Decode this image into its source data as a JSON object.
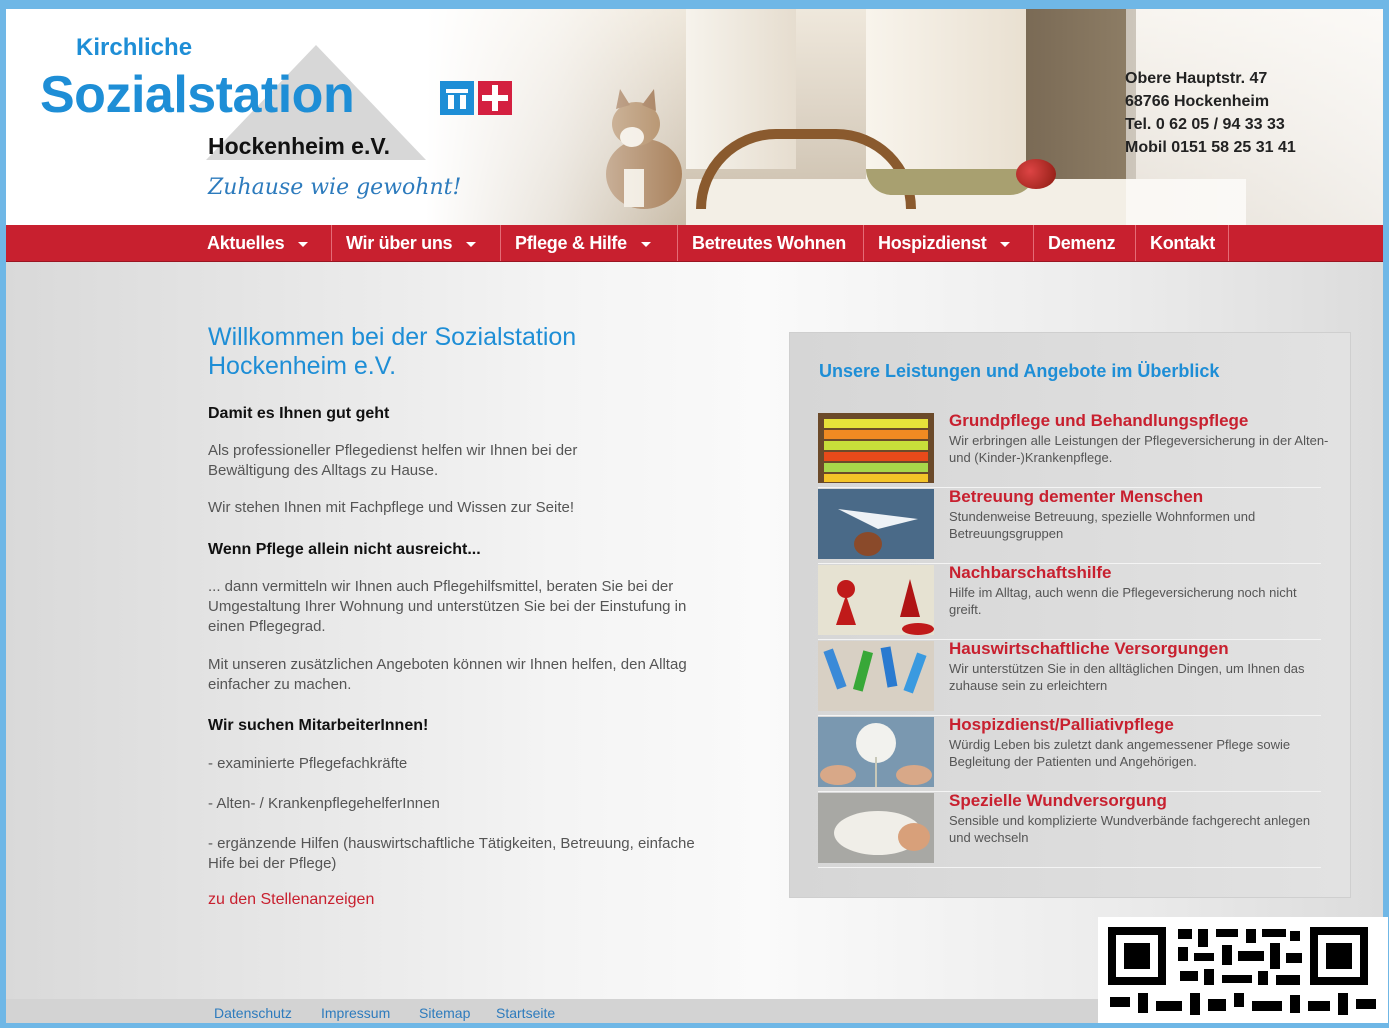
{
  "header": {
    "logo_small": "Kirchliche",
    "logo_big": "Sozialstation",
    "logo_sub": "Hockenheim e.V.",
    "slogan": "Zuhause wie gewohnt!",
    "contact": [
      "Obere Hauptstr. 47",
      "68766 Hockenheim",
      "Tel. 0 62 05 / 94 33 33",
      "Mobil 0151 58 25 31 41"
    ]
  },
  "nav": {
    "items": [
      {
        "label": "Aktuelles"
      },
      {
        "label": "Wir über uns"
      },
      {
        "label": "Pflege & Hilfe"
      },
      {
        "label": "Betreutes Wohnen"
      },
      {
        "label": "Hospizdienst"
      },
      {
        "label": "Demenz"
      },
      {
        "label": "Kontakt"
      }
    ]
  },
  "main": {
    "welcome": "Willkommen bei der Sozialstation Hockenheim e.V.",
    "h1": "Damit es Ihnen gut geht",
    "p1": "Als professioneller Pflegedienst helfen wir Ihnen bei der Bewältigung des Alltags zu Hause.",
    "p2": "Wir stehen Ihnen mit Fachpflege und Wissen zur Seite!",
    "h2": "Wenn Pflege allein nicht ausreicht...",
    "p3": "... dann vermitteln wir Ihnen auch Pflegehilfsmittel, beraten Sie bei der Umgestaltung Ihrer Wohnung und unterstützen Sie bei der Einstufung in einen Pflegegrad.",
    "p4": "Mit unseren zusätzlichen Angeboten können wir Ihnen helfen, den Alltag einfacher zu machen.",
    "h3": "Wir suchen MitarbeiterInnen!",
    "job1": "- examinierte Pflegefachkräfte",
    "job2": "- Alten- / KrankenpflegehelferInnen",
    "job3": "- ergänzende Hilfen (hauswirtschaftliche Tätigkeiten, Betreuung, einfache Hife bei der Pflege)",
    "jobs_link": "zu den Stellenanzeigen"
  },
  "services": {
    "title": "Unsere Leistungen und Angebote im Überblick",
    "items": [
      {
        "title": "Grundpflege und Behandlungspflege",
        "desc": "Wir erbringen alle Leistungen der Pflegeversicherung in der Alten- und (Kinder-)Krankenpflege."
      },
      {
        "title": "Betreuung dementer Menschen",
        "desc": "Stundenweise Betreuung, spezielle Wohnformen und Betreuungsgruppen"
      },
      {
        "title": "Nachbarschaftshilfe",
        "desc": "Hilfe im Alltag, auch wenn die Pflegeversicherung noch nicht greift."
      },
      {
        "title": "Hauswirtschaftliche Versorgungen",
        "desc": "Wir unterstützen Sie in den alltäglichen Dingen, um Ihnen das zuhause sein zu erleichtern"
      },
      {
        "title": "Hospizdienst/Palliativpflege",
        "desc": "Würdig Leben bis zuletzt dank angemessener Pflege sowie Begleitung der Patienten und Angehörigen."
      },
      {
        "title": "Spezielle Wundversorgung",
        "desc": "Sensible und komplizierte Wundverbände fachgerecht anlegen und wechseln"
      }
    ]
  },
  "footer": {
    "links": [
      "Datenschutz",
      "Impressum",
      "Sitemap",
      "Startseite"
    ]
  },
  "colors": {
    "brand_blue": "#1e8ed6",
    "brand_red": "#c8202f",
    "frame_blue": "#6fb7e6"
  }
}
